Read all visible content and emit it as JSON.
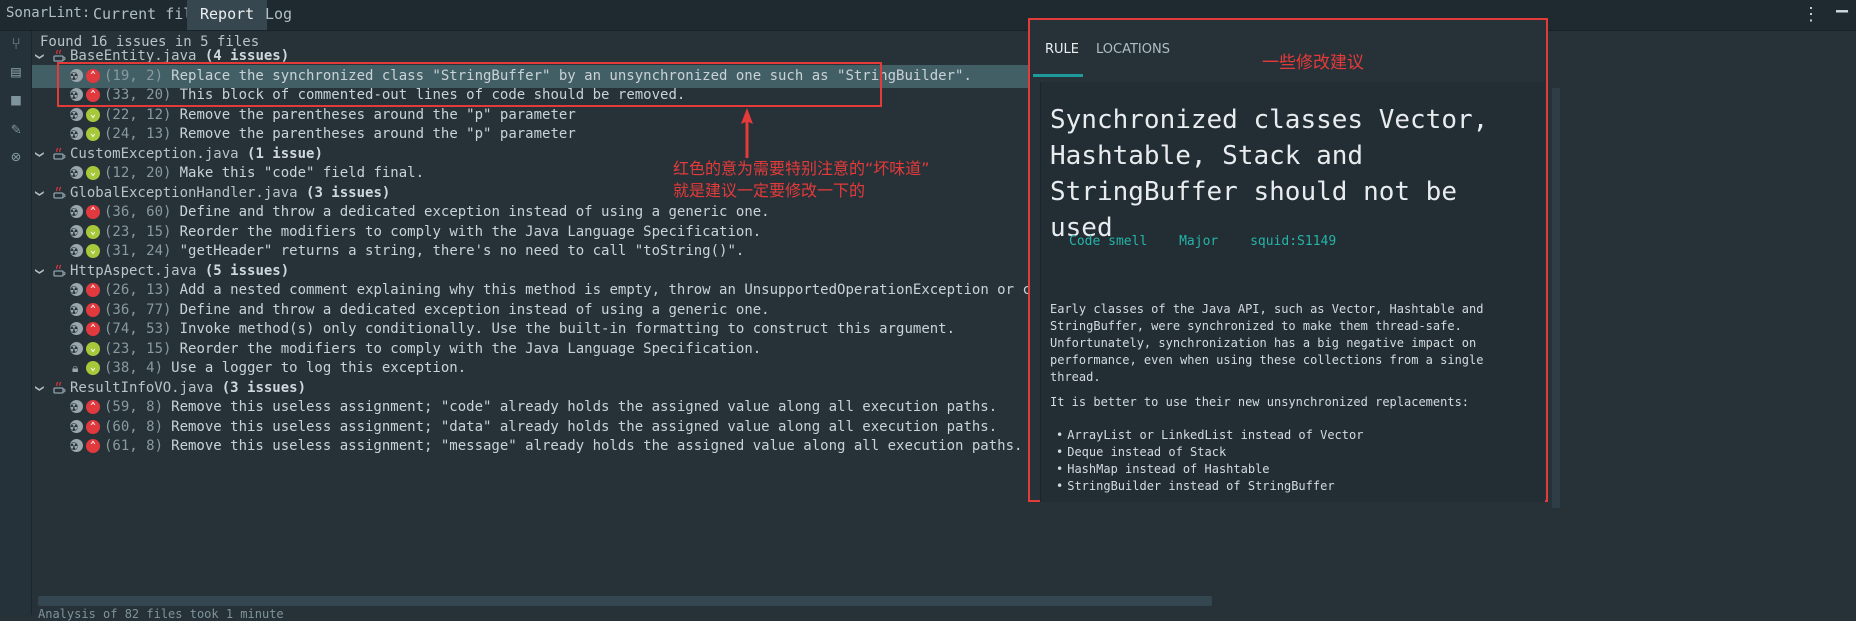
{
  "topbar": {
    "app_label": "SonarLint:",
    "tabs": [
      "Current file",
      "Report",
      "Log"
    ],
    "active_tab": "Report"
  },
  "left_strip": {
    "icons": [
      "branch-icon",
      "folder-icon",
      "stop-icon",
      "wrench-icon",
      "close-circle-icon"
    ]
  },
  "tree": {
    "summary": "Found 16 issues in 5 files",
    "files": [
      {
        "name": "BaseEntity.java",
        "count": "(4 issues)",
        "issues": [
          {
            "loc": "(19, 2)",
            "sev": "major",
            "msg": "Replace the synchronized class \"StringBuffer\" by an unsynchronized one such as \"StringBuilder\".",
            "selected": true
          },
          {
            "loc": "(33, 20)",
            "sev": "major",
            "msg": "This block of commented-out lines of code should be removed."
          },
          {
            "loc": "(22, 12)",
            "sev": "minor",
            "msg": "Remove the parentheses around the \"p\" parameter"
          },
          {
            "loc": "(24, 13)",
            "sev": "minor",
            "msg": "Remove the parentheses around the \"p\" parameter"
          }
        ]
      },
      {
        "name": "CustomException.java",
        "count": "(1 issue)",
        "issues": [
          {
            "loc": "(12, 20)",
            "sev": "minor",
            "msg": "Make this \"code\" field final."
          }
        ]
      },
      {
        "name": "GlobalExceptionHandler.java",
        "count": "(3 issues)",
        "issues": [
          {
            "loc": "(36, 60)",
            "sev": "major",
            "msg": "Define and throw a dedicated exception instead of using a generic one."
          },
          {
            "loc": "(23, 15)",
            "sev": "minor",
            "msg": "Reorder the modifiers to comply with the Java Language Specification."
          },
          {
            "loc": "(31, 24)",
            "sev": "minor",
            "msg": "\"getHeader\" returns a string, there's no need to call \"toString()\"."
          }
        ]
      },
      {
        "name": "HttpAspect.java",
        "count": "(5 issues)",
        "issues": [
          {
            "loc": "(26, 13)",
            "sev": "critical",
            "msg": "Add a nested comment explaining why this method is empty, throw an UnsupportedOperationException or complete the implementation."
          },
          {
            "loc": "(36, 77)",
            "sev": "major",
            "msg": "Define and throw a dedicated exception instead of using a generic one."
          },
          {
            "loc": "(74, 53)",
            "sev": "major",
            "msg": "Invoke method(s) only conditionally. Use the built-in formatting to construct this argument."
          },
          {
            "loc": "(23, 15)",
            "sev": "minor",
            "msg": "Reorder the modifiers to comply with the Java Language Specification."
          },
          {
            "loc": "(38, 4)",
            "sev": "minor",
            "msg": "Use a logger to log this exception.",
            "lock": true
          }
        ]
      },
      {
        "name": "ResultInfoVO.java",
        "count": "(3 issues)",
        "issues": [
          {
            "loc": "(59, 8)",
            "sev": "major",
            "msg": "Remove this useless assignment; \"code\" already holds the assigned value along all execution paths."
          },
          {
            "loc": "(60, 8)",
            "sev": "major",
            "msg": "Remove this useless assignment; \"data\" already holds the assigned value along all execution paths."
          },
          {
            "loc": "(61, 8)",
            "sev": "major",
            "msg": "Remove this useless assignment; \"message\" already holds the assigned value along all execution paths."
          }
        ]
      }
    ],
    "bottom_text": "Analysis of 82 files took 1 minute"
  },
  "annotations": {
    "note1_line1": "红色的意为需要特别注意的“坏味道”",
    "note1_line2": "就是建议一定要修改一下的",
    "note2": "一些修改建议",
    "accent": "#e53a3a"
  },
  "rule_panel": {
    "tabs": [
      "RULE",
      "LOCATIONS"
    ],
    "title": "Synchronized classes Vector, Hashtable, Stack and StringBuffer should not be used",
    "tags": [
      "Code smell",
      "Major",
      "squid:S1149"
    ],
    "para1": "Early classes of the Java API, such as Vector, Hashtable and StringBuffer, were synchronized to make them thread-safe. Unfortunately, synchronization has a big negative impact on performance, even when using these collections from a single thread.",
    "para2": "It is better to use their new unsynchronized replacements:",
    "bullets": [
      "ArrayList or LinkedList instead of Vector",
      "Deque instead of Stack",
      "HashMap instead of Hashtable",
      "StringBuilder instead of StringBuffer"
    ]
  }
}
